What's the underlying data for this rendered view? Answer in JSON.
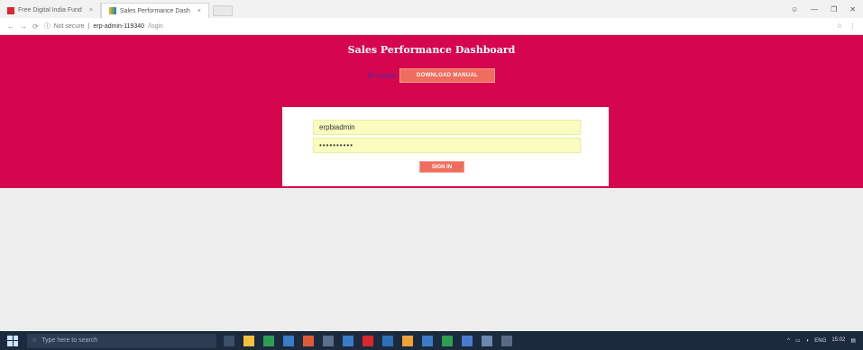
{
  "browser": {
    "tabs": [
      {
        "title": "Free Digital India Fund",
        "icon": "red-square-icon",
        "active": false
      },
      {
        "title": "Sales Performance Dash",
        "icon": "chart-icon",
        "active": true
      }
    ],
    "address": {
      "security": "Not secure",
      "host": "erp-admin-119340",
      "path": "/login"
    }
  },
  "page": {
    "title": "Sales Performance Dashboard",
    "manual_link": "BI Guide",
    "download_button": "DOWNLOAD MANUAL",
    "login": {
      "username_value": "erpbiadmin",
      "password_value": "••••••••••",
      "signin_label": "SIGN IN"
    },
    "colors": {
      "hero": "#d6064e",
      "button": "#ef6d5e",
      "input_bg": "#fafcc0"
    }
  },
  "taskbar": {
    "search_placeholder": "Type here to search",
    "time": "15:02",
    "date": "ENG"
  }
}
